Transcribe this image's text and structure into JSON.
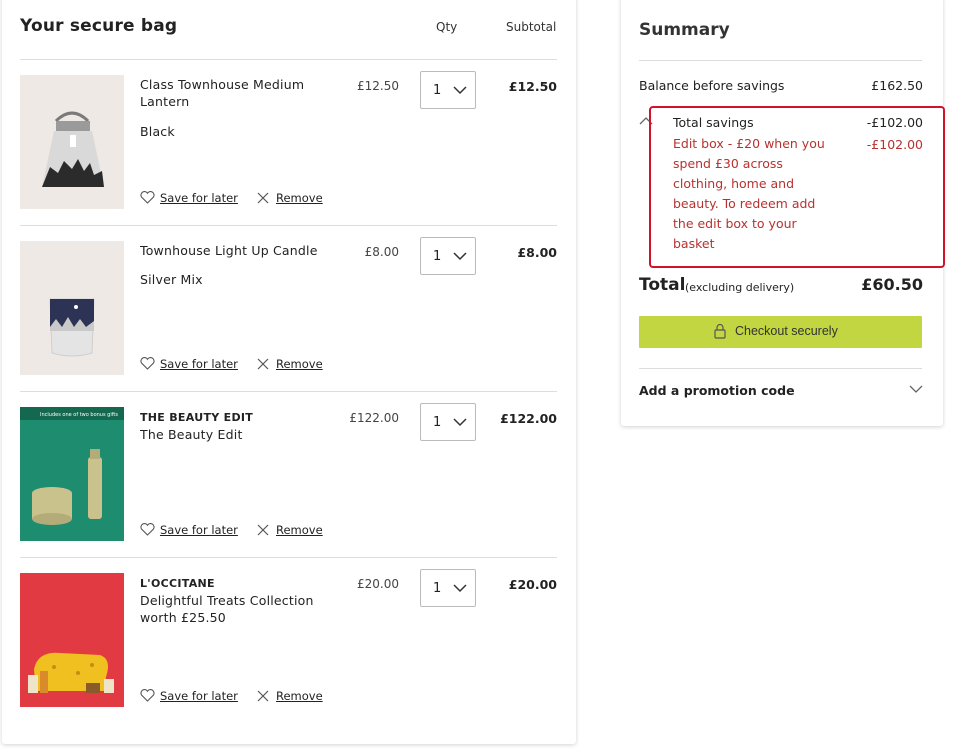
{
  "bag": {
    "title": "Your secure bag",
    "qty_header": "Qty",
    "subtotal_header": "Subtotal",
    "save_label": "Save for later",
    "remove_label": "Remove",
    "items": [
      {
        "brand": "",
        "name": "Class Townhouse Medium Lantern",
        "variant": "Black",
        "price": "£12.50",
        "qty": "1",
        "subtotal": "£12.50"
      },
      {
        "brand": "",
        "name": "Townhouse Light Up Candle",
        "variant": "Silver Mix",
        "price": "£8.00",
        "qty": "1",
        "subtotal": "£8.00"
      },
      {
        "brand": "THE BEAUTY EDIT",
        "name": "The Beauty Edit",
        "variant": "",
        "price": "£122.00",
        "qty": "1",
        "subtotal": "£122.00",
        "image_banner": "Includes one of two bonus gifts"
      },
      {
        "brand": "L'OCCITANE",
        "name": "Delightful Treats Collection worth £25.50",
        "variant": "",
        "price": "£20.00",
        "qty": "1",
        "subtotal": "£20.00"
      }
    ]
  },
  "summary": {
    "title": "Summary",
    "balance_label": "Balance before savings",
    "balance_value": "£162.50",
    "savings_label": "Total savings",
    "savings_value": "-£102.00",
    "promo_description": "Edit box - £20 when you spend £30 across clothing, home and beauty. To redeem add the edit box to your basket",
    "promo_value": "-£102.00",
    "total_label": "Total",
    "total_note": "(excluding delivery)",
    "total_value": "£60.50",
    "checkout_label": "Checkout securely",
    "promo_code_label": "Add a promotion code"
  },
  "colors": {
    "accent_button": "#c1d640",
    "savings_text": "#b8312f",
    "highlight_box": "#d0122a"
  }
}
